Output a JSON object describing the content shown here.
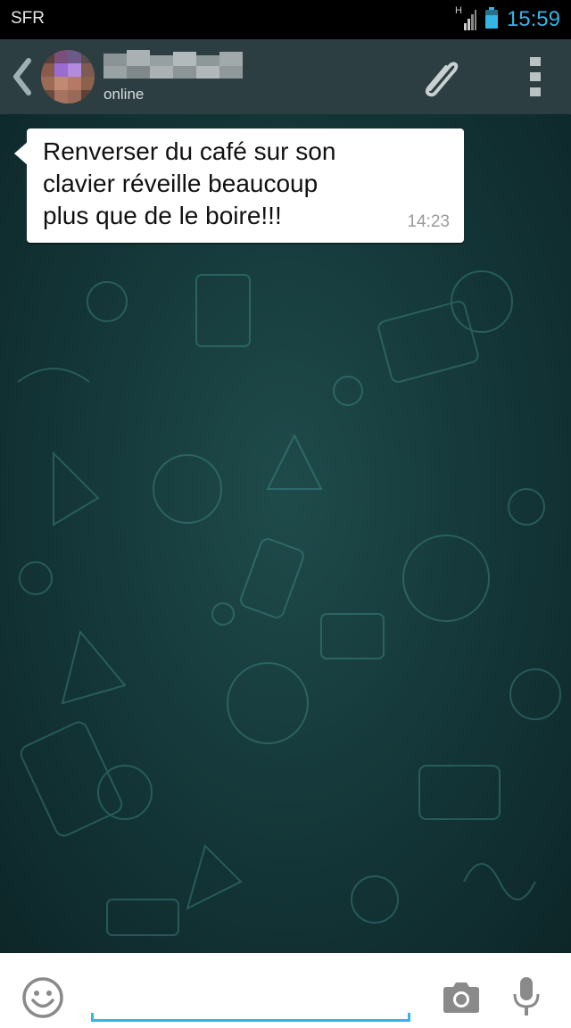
{
  "status_bar": {
    "carrier": "SFR",
    "network_type": "H",
    "time": "15:59",
    "accent_color": "#33b5e5"
  },
  "chat_header": {
    "presence": "online",
    "icons": [
      "back-chevron-icon",
      "avatar",
      "paperclip-icon",
      "overflow-menu-icon"
    ]
  },
  "conversation": {
    "messages": [
      {
        "lines": [
          "Renverser du café sur son",
          "clavier réveille beaucoup",
          "plus que de le boire!!!"
        ],
        "time": "14:23"
      }
    ]
  },
  "input_bar": {
    "message_value": "",
    "icons": [
      "emoji-icon",
      "camera-icon",
      "microphone-icon"
    ],
    "underline_color": "#33b5e5"
  }
}
